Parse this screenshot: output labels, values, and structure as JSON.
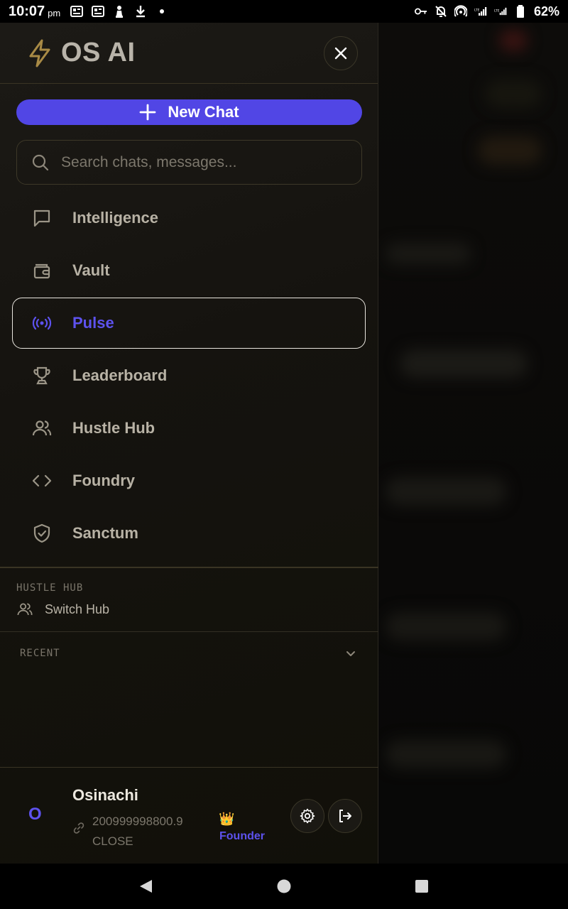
{
  "status_bar": {
    "time": "10:07",
    "ampm": "pm",
    "battery": "62%",
    "icons": [
      "news-icon",
      "news-icon",
      "chess-icon",
      "download-icon",
      "dot-icon",
      "key-icon",
      "bell-off-icon",
      "hotspot-icon",
      "signal-lte-icon",
      "signal-lte-icon",
      "battery-icon"
    ]
  },
  "drawer": {
    "brand": {
      "title": "OS AI",
      "icon": "lightning-icon"
    },
    "new_chat_label": "New Chat",
    "search_placeholder": "Search chats, messages...",
    "nav_items": [
      {
        "label": "Intelligence",
        "icon": "chat-bubble-icon",
        "active": false
      },
      {
        "label": "Vault",
        "icon": "wallet-icon",
        "active": false
      },
      {
        "label": "Pulse",
        "icon": "broadcast-icon",
        "active": true
      },
      {
        "label": "Leaderboard",
        "icon": "trophy-icon",
        "active": false
      },
      {
        "label": "Hustle Hub",
        "icon": "users-icon",
        "active": false
      },
      {
        "label": "Foundry",
        "icon": "code-icon",
        "active": false
      },
      {
        "label": "Sanctum",
        "icon": "shield-check-icon",
        "active": false
      }
    ],
    "hub_section": {
      "heading": "HUSTLE HUB",
      "switch_label": "Switch Hub"
    },
    "recent_section": {
      "heading": "RECENT"
    },
    "user": {
      "avatar_letter": "O",
      "name": "Osinachi",
      "id_line1": "200999998800.9",
      "id_line2": "CLOSE",
      "role_emoji": "👑",
      "role": "Founder"
    }
  },
  "colors": {
    "accent": "#5146e5",
    "active_text": "#5d52ee",
    "drawer_bg": "#16140f",
    "divider": "#3a3424"
  }
}
